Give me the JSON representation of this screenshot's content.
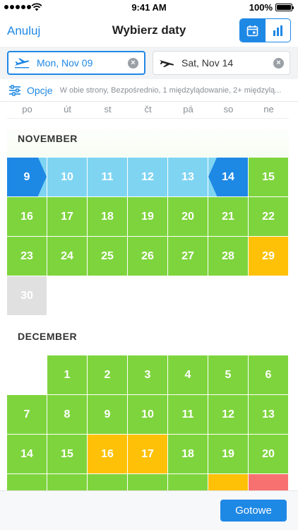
{
  "status_bar": {
    "time": "9:41 AM",
    "battery": "100%"
  },
  "nav": {
    "cancel_label": "Anuluj",
    "title": "Wybierz daty",
    "views": [
      {
        "icon": "calendar-icon",
        "active": true
      },
      {
        "icon": "bar-chart-icon",
        "active": false
      }
    ]
  },
  "search": {
    "outbound": {
      "icon": "departure-plane-icon",
      "value": "Mon, Nov 09"
    },
    "return": {
      "icon": "arrival-plane-icon",
      "value": "Sat, Nov 14"
    }
  },
  "options": {
    "label": "Opcje",
    "summary": "W obie strony, Bezpośrednio, 1 międzylądowanie, 2+ międzylą..."
  },
  "weekdays": [
    "po",
    "út",
    "st",
    "čt",
    "pá",
    "so",
    "ne"
  ],
  "colors": {
    "accent": "#1e88e5",
    "cheap": "#7ed43d",
    "medium": "#ffc107",
    "expensive": "#f87171",
    "unavailable": "#e0e0e0",
    "selected_range": "#7fd4f2"
  },
  "calendar": {
    "months": [
      {
        "name": "NOVEMBER",
        "offset": 0,
        "days": [
          {
            "d": "9",
            "s": "start"
          },
          {
            "d": "10",
            "s": "range"
          },
          {
            "d": "11",
            "s": "range"
          },
          {
            "d": "12",
            "s": "range"
          },
          {
            "d": "13",
            "s": "range"
          },
          {
            "d": "14",
            "s": "end"
          },
          {
            "d": "15",
            "s": "green"
          },
          {
            "d": "16",
            "s": "green"
          },
          {
            "d": "17",
            "s": "green"
          },
          {
            "d": "18",
            "s": "green"
          },
          {
            "d": "19",
            "s": "green"
          },
          {
            "d": "20",
            "s": "green"
          },
          {
            "d": "21",
            "s": "green"
          },
          {
            "d": "22",
            "s": "green"
          },
          {
            "d": "23",
            "s": "green"
          },
          {
            "d": "24",
            "s": "green"
          },
          {
            "d": "25",
            "s": "green"
          },
          {
            "d": "26",
            "s": "green"
          },
          {
            "d": "27",
            "s": "green"
          },
          {
            "d": "28",
            "s": "green"
          },
          {
            "d": "29",
            "s": "yellow"
          },
          {
            "d": "30",
            "s": "gray"
          }
        ]
      },
      {
        "name": "DECEMBER",
        "offset": 1,
        "days": [
          {
            "d": "1",
            "s": "green"
          },
          {
            "d": "2",
            "s": "green"
          },
          {
            "d": "3",
            "s": "green"
          },
          {
            "d": "4",
            "s": "green"
          },
          {
            "d": "5",
            "s": "green"
          },
          {
            "d": "6",
            "s": "green"
          },
          {
            "d": "7",
            "s": "green"
          },
          {
            "d": "8",
            "s": "green"
          },
          {
            "d": "9",
            "s": "green"
          },
          {
            "d": "10",
            "s": "green"
          },
          {
            "d": "11",
            "s": "green"
          },
          {
            "d": "12",
            "s": "green"
          },
          {
            "d": "13",
            "s": "green"
          },
          {
            "d": "14",
            "s": "green"
          },
          {
            "d": "15",
            "s": "green"
          },
          {
            "d": "16",
            "s": "yellow"
          },
          {
            "d": "17",
            "s": "yellow"
          },
          {
            "d": "18",
            "s": "green"
          },
          {
            "d": "19",
            "s": "green"
          },
          {
            "d": "20",
            "s": "green"
          },
          {
            "d": "",
            "s": "green"
          },
          {
            "d": "",
            "s": "green"
          },
          {
            "d": "",
            "s": "green"
          },
          {
            "d": "",
            "s": "green"
          },
          {
            "d": "",
            "s": "green"
          },
          {
            "d": "",
            "s": "yellow"
          },
          {
            "d": "",
            "s": "red"
          }
        ]
      }
    ]
  },
  "footer": {
    "done_label": "Gotowe"
  }
}
